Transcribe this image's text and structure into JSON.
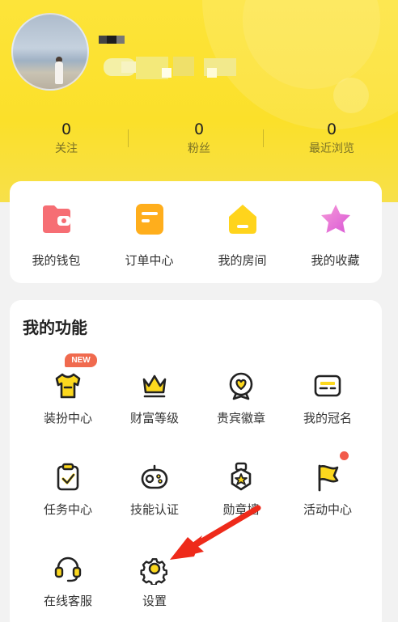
{
  "profile": {
    "stats": [
      {
        "value": "0",
        "label": "关注"
      },
      {
        "value": "0",
        "label": "粉丝"
      },
      {
        "value": "0",
        "label": "最近浏览"
      }
    ]
  },
  "quick_actions": [
    {
      "label": "我的钱包",
      "icon": "wallet-icon",
      "color": "#f56b6b"
    },
    {
      "label": "订单中心",
      "icon": "order-icon",
      "color": "#ffb020"
    },
    {
      "label": "我的房间",
      "icon": "room-icon",
      "color": "#ffd21a"
    },
    {
      "label": "我的收藏",
      "icon": "star-icon",
      "color": "#f06bd8"
    }
  ],
  "functions": {
    "title": "我的功能",
    "new_badge": "NEW",
    "items": [
      {
        "label": "装扮中心",
        "icon": "tshirt-icon"
      },
      {
        "label": "财富等级",
        "icon": "crown-icon"
      },
      {
        "label": "贵宾徽章",
        "icon": "vip-badge-icon"
      },
      {
        "label": "我的冠名",
        "icon": "name-card-icon"
      },
      {
        "label": "任务中心",
        "icon": "clipboard-check-icon"
      },
      {
        "label": "技能认证",
        "icon": "gamepad-icon"
      },
      {
        "label": "勋章墙",
        "icon": "medal-icon"
      },
      {
        "label": "活动中心",
        "icon": "flag-icon"
      },
      {
        "label": "在线客服",
        "icon": "headset-icon"
      },
      {
        "label": "设置",
        "icon": "gear-icon"
      }
    ]
  },
  "colors": {
    "header_yellow": "#fde43a",
    "icon_yellow": "#fcd81e",
    "icon_stroke": "#222222",
    "annotation_arrow": "#ee2a1a"
  }
}
